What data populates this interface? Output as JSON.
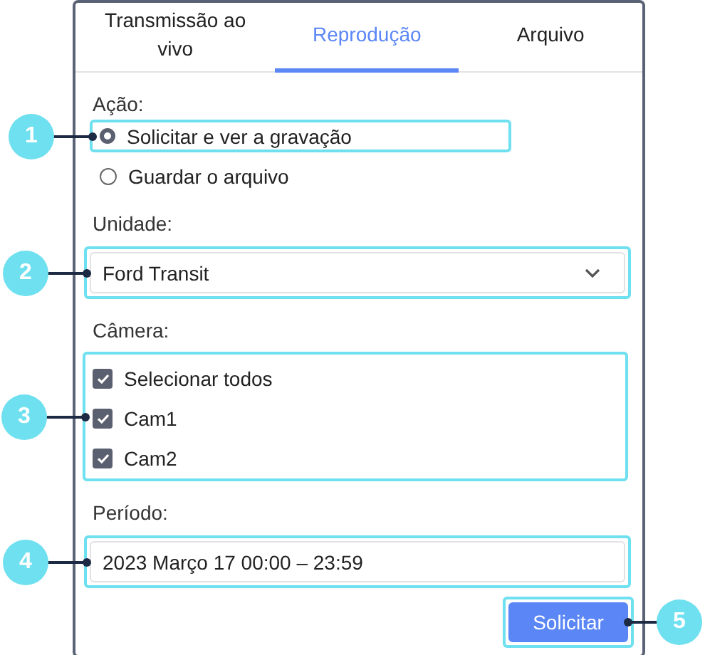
{
  "tabs": [
    {
      "label": "Transmissão ao vivo",
      "selected": false
    },
    {
      "label": "Reprodução",
      "selected": true
    },
    {
      "label": "Arquivo",
      "selected": false
    }
  ],
  "action": {
    "label": "Ação:",
    "callout": "1",
    "options": [
      {
        "label": "Solicitar e ver a gravação",
        "selected": true
      },
      {
        "label": "Guardar o arquivo",
        "selected": false
      }
    ]
  },
  "unit": {
    "label": "Unidade:",
    "value": "Ford Transit",
    "callout": "2"
  },
  "camera": {
    "label": "Câmera:",
    "callout": "3",
    "items": [
      {
        "label": "Selecionar todos",
        "checked": true
      },
      {
        "label": "Cam1",
        "checked": true
      },
      {
        "label": "Cam2",
        "checked": true
      }
    ]
  },
  "period": {
    "label": "Período:",
    "value": "2023 Março 17 00:00 – 23:59",
    "callout": "4"
  },
  "submit": {
    "label": "Solicitar",
    "callout": "5"
  }
}
